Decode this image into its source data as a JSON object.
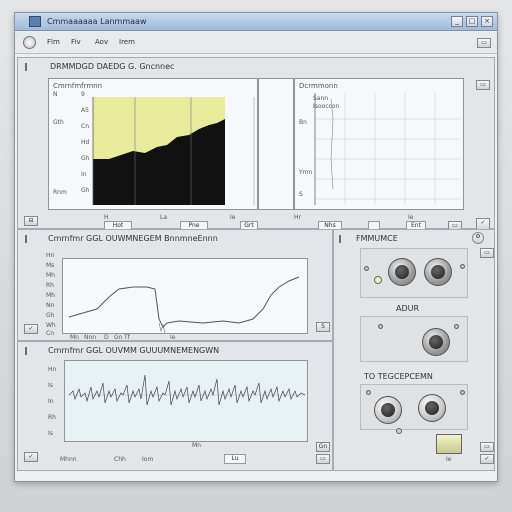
{
  "window": {
    "title": "Cmmaaaaaa Lanmmaaw",
    "buttons": [
      "_",
      "□",
      "×"
    ]
  },
  "toolbar": {
    "items": [
      "Flm",
      "Fiv",
      "Aov",
      "Irem"
    ]
  },
  "top_panel": {
    "header": "DRMMDGD  DAEDG  G.  Gncnnec",
    "left_plot_title": "Cmrnfmfrmnn",
    "left_side_labels": [
      "N",
      "Gth",
      "Rnm"
    ],
    "left_y_ticks": [
      "9",
      "A5",
      "Cn",
      "Hd",
      "Gh",
      "In",
      "Gh"
    ],
    "left_bottom_labels": [
      "H",
      "La",
      "Ie"
    ],
    "left_controls": [
      "Hot",
      "Pne",
      "Grt"
    ],
    "right_plot_title": "Dcrmmonn",
    "right_side_labels": [
      "Bn",
      "Ymn",
      "S"
    ],
    "right_bottom_labels": [
      "Hr",
      "Ie"
    ],
    "right_controls": [
      "Nhs",
      "Ent"
    ],
    "right_y_ticks": [
      "Sann",
      "Isooccon"
    ],
    "fill_color": "#e8ec9a"
  },
  "mid_panel": {
    "header": "Cmrnfmr  GGL  OUWMNEGEM  BnnmneEnnn",
    "y_ticks": [
      "Hn",
      "Ms",
      "Mh",
      "Rh",
      "Mh",
      "Nn",
      "Gh",
      "Wh",
      "Cn"
    ],
    "x_labels": [
      "Mn",
      "Nnn",
      "D",
      "Gn",
      "Tf",
      "Ie"
    ],
    "status": "S",
    "line_color": "#555555"
  },
  "low_panel": {
    "header": "Cmrnfmr  GGL  OUVMM  GUUUMNEMENGWN",
    "y_ticks": [
      "Hn",
      "Is",
      "In",
      "Rh",
      "Is"
    ],
    "x_labels": [
      "Mhnn",
      "Chh",
      "Iom",
      "Mn",
      "Lu"
    ],
    "status": "Gn",
    "plot_bg": "#e8f1f4"
  },
  "right_panel": {
    "section1": "FMMUMCE",
    "section2": "ADUR",
    "section3": "TO  TEGCEPCEMN",
    "status": "Ie",
    "led_color": "#f0f0c0"
  }
}
